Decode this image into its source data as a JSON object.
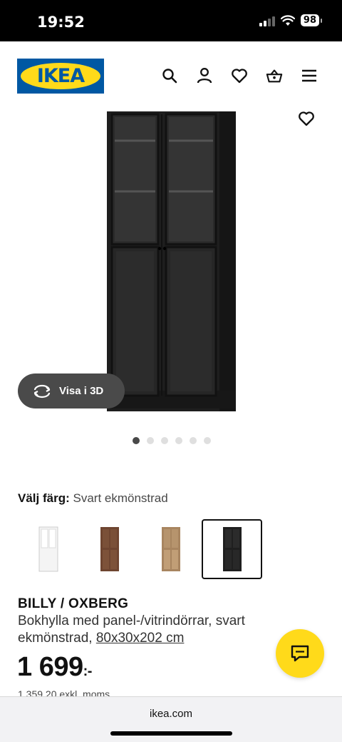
{
  "status_bar": {
    "time": "19:52",
    "battery": "98"
  },
  "header": {
    "logo_text": "IKEA",
    "icons": [
      "search-icon",
      "user-icon",
      "heart-icon",
      "basket-icon",
      "menu-icon"
    ]
  },
  "gallery": {
    "view_3d_label": "Visa i 3D",
    "dot_count": 6,
    "active_dot": 0
  },
  "color_picker": {
    "label": "Välj färg:",
    "selected_value": "Svart ekmönstrad",
    "swatches": [
      "white",
      "walnut",
      "oak",
      "black"
    ],
    "selected_index": 3
  },
  "product": {
    "name": "BILLY / OXBERG",
    "description": "Bokhylla med panel-/vitrindörrar, svart ekmönstrad, ",
    "dimensions": "80x30x202 cm",
    "price": "1 699",
    "price_suffix": ":-",
    "price_ex_vat": "1 359,20 exkl. moms"
  },
  "browser": {
    "url": "ikea.com"
  },
  "colors": {
    "ikea_blue": "#0058a3",
    "ikea_yellow": "#ffda1a",
    "product_black": "#1f1f1f"
  }
}
